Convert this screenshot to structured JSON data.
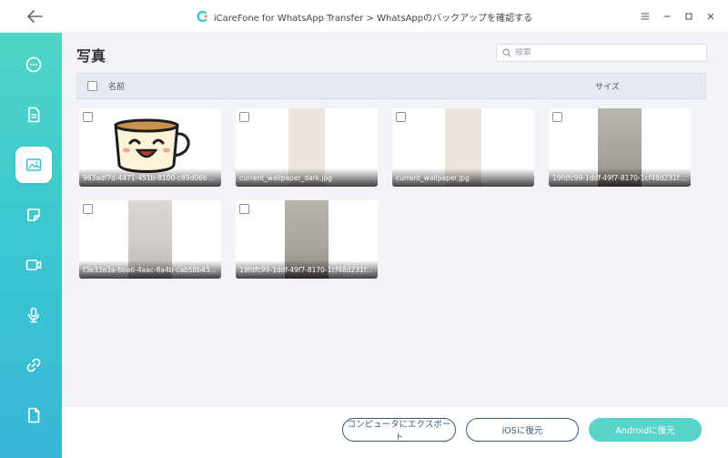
{
  "window": {
    "title": "iCareFone for WhatsApp Transfer > WhatsAppのバックアップを確認する"
  },
  "sidebar": {
    "items": [
      {
        "icon": "chat-icon",
        "active": false
      },
      {
        "icon": "document-icon",
        "active": false
      },
      {
        "icon": "photo-icon",
        "active": true
      },
      {
        "icon": "sticker-icon",
        "active": false
      },
      {
        "icon": "video-icon",
        "active": false
      },
      {
        "icon": "microphone-icon",
        "active": false
      },
      {
        "icon": "link-icon",
        "active": false
      },
      {
        "icon": "file-icon",
        "active": false
      }
    ]
  },
  "main": {
    "title": "写真",
    "search_placeholder": "検索",
    "columns": {
      "name": "名前",
      "size": "サイズ"
    }
  },
  "photos": [
    {
      "name": "963adf7d-4471-451b-8100-c89d06b95...",
      "kind": "cup-sticker"
    },
    {
      "name": "current_wallpaper_dark.jpg",
      "kind": "beige"
    },
    {
      "name": "current_wallpaper.jpg",
      "kind": "beige"
    },
    {
      "name": "19fdfc99-1ddf-49f7-8170-1cf48d231fa...",
      "kind": "grey"
    },
    {
      "name": "f3e33e3a-6ba6-4aac-8a4b-cab58b437...",
      "kind": "light-grey"
    },
    {
      "name": "19fdfc99-1ddf-49f7-8170-1cf48d231fa...",
      "kind": "grey"
    }
  ],
  "footer": {
    "export_label": "コンピュータにエクスポート",
    "restore_ios_label": "iOSに復元",
    "restore_android_label": "Androidに復元"
  },
  "colors": {
    "accent": "#5ad4cb",
    "sidebar_top": "#4ed6c6",
    "sidebar_bottom": "#38b7d8",
    "outline_button": "#3a5a78"
  }
}
